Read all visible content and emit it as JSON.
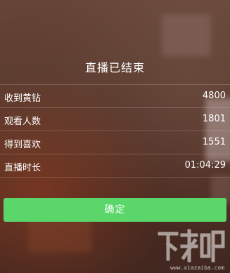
{
  "dialog": {
    "title": "直播已结束",
    "confirm_label": "确定"
  },
  "stats": [
    {
      "label": "收到黄钻",
      "value": "4800"
    },
    {
      "label": "观看人数",
      "value": "1801"
    },
    {
      "label": "得到喜欢",
      "value": "1551"
    },
    {
      "label": "直播时长",
      "value": "01:04:29"
    }
  ],
  "watermark": {
    "url": "www.xiazaiba.com"
  },
  "colors": {
    "confirm_button": "#5ad66a",
    "text": "#ffffff"
  }
}
